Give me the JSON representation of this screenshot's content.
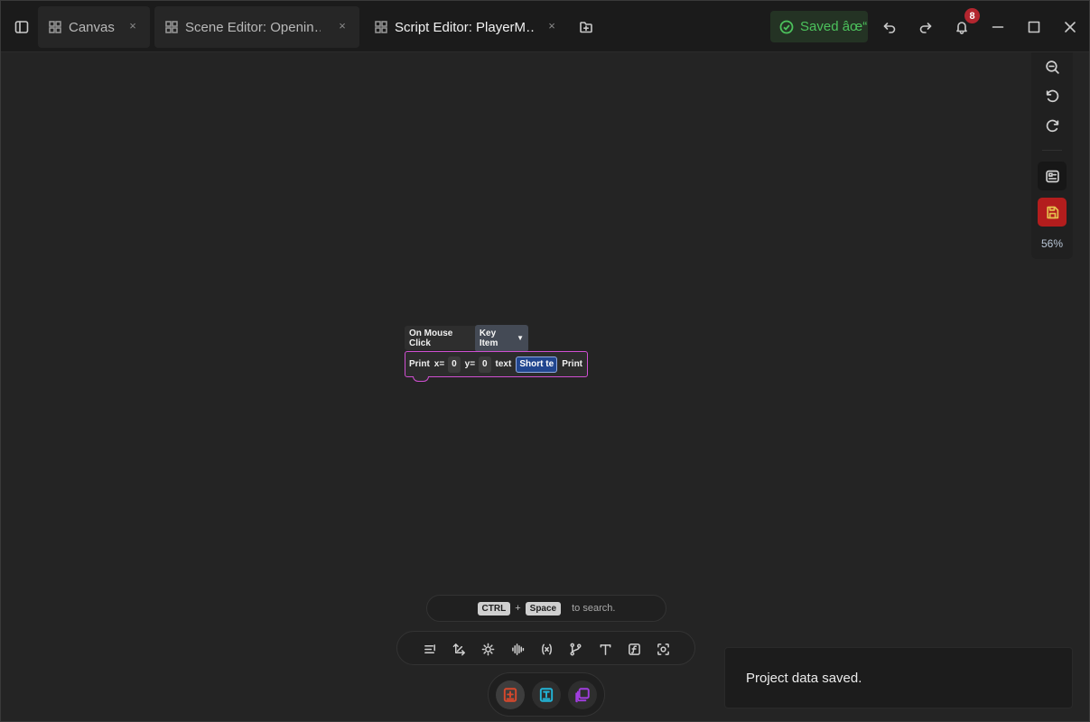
{
  "tabs": [
    {
      "label": "Canvas",
      "icon": "layout-grid-icon",
      "active": false
    },
    {
      "label": "Scene Editor: Openin…",
      "icon": "layout-grid-icon",
      "active": false
    },
    {
      "label": "Script Editor: PlayerM…",
      "icon": "layout-grid-icon",
      "active": true
    }
  ],
  "tab_close_glyph": "×",
  "status": {
    "saved_label": "Saved âœ“",
    "notification_count": "8"
  },
  "canvas": {
    "event_block": {
      "label": "On Mouse Click",
      "dropdown_value": "Key Item"
    },
    "print_block": {
      "label": "Print",
      "x_label": "x=",
      "x_value": "0",
      "y_label": "y=",
      "y_value": "0",
      "text_label": "text",
      "text_value": "Short te",
      "trailing_label": "Print"
    }
  },
  "right_toolbar": {
    "zoom_level": "56%"
  },
  "search_hint": {
    "key1": "CTRL",
    "plus": "+",
    "key2": "Space",
    "text": "to search."
  },
  "toast": {
    "message": "Project data saved."
  },
  "colors": {
    "accent_saved": "#4cc25c",
    "save_button": "#b31d1d",
    "block_outline": "#d04fd2",
    "badge": "#b3262f"
  }
}
